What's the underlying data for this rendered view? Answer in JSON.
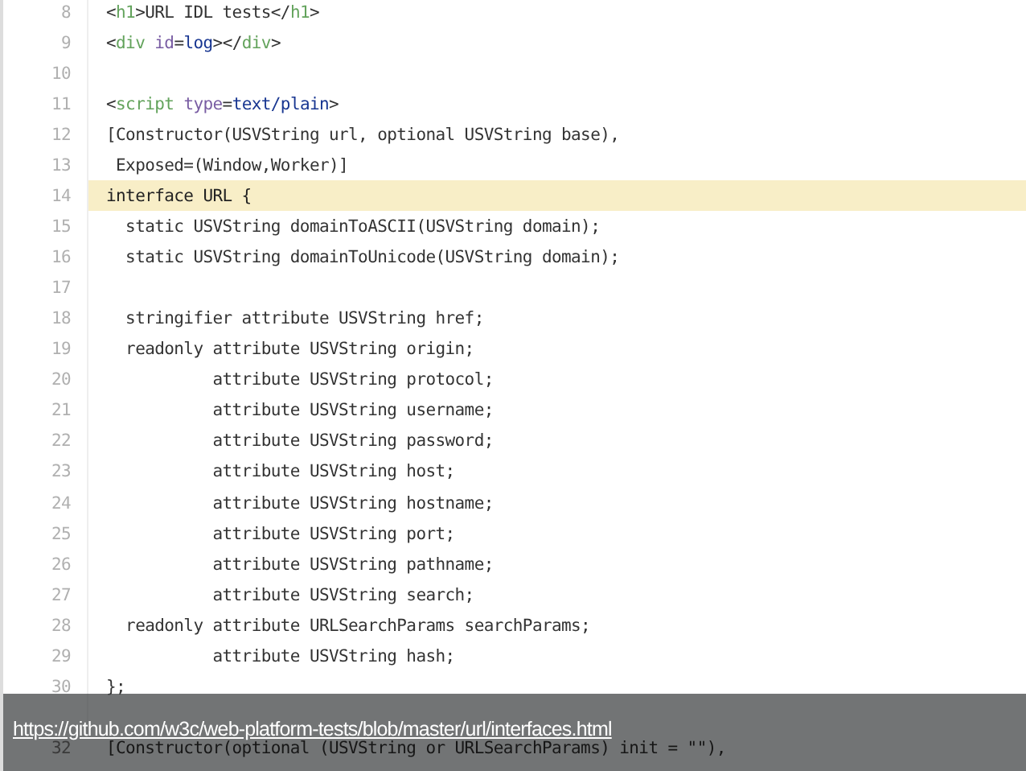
{
  "code_lines": [
    {
      "number": "8",
      "highlighted": false,
      "tokens": [
        {
          "text": "<",
          "kind": "plain"
        },
        {
          "text": "h1",
          "kind": "tag"
        },
        {
          "text": ">URL IDL tests</",
          "kind": "plain"
        },
        {
          "text": "h1",
          "kind": "tag"
        },
        {
          "text": ">",
          "kind": "plain"
        }
      ]
    },
    {
      "number": "9",
      "highlighted": false,
      "tokens": [
        {
          "text": "<",
          "kind": "plain"
        },
        {
          "text": "div",
          "kind": "tag"
        },
        {
          "text": " id",
          "kind": "attr"
        },
        {
          "text": "=",
          "kind": "plain"
        },
        {
          "text": "log",
          "kind": "value"
        },
        {
          "text": "></",
          "kind": "plain"
        },
        {
          "text": "div",
          "kind": "tag"
        },
        {
          "text": ">",
          "kind": "plain"
        }
      ]
    },
    {
      "number": "10",
      "highlighted": false
    },
    {
      "number": "11",
      "highlighted": false,
      "tokens": [
        {
          "text": "<",
          "kind": "plain"
        },
        {
          "text": "script",
          "kind": "tag"
        },
        {
          "text": " type",
          "kind": "attr"
        },
        {
          "text": "=",
          "kind": "plain"
        },
        {
          "text": "text/plain",
          "kind": "value"
        },
        {
          "text": ">",
          "kind": "plain"
        }
      ]
    },
    {
      "number": "12",
      "highlighted": false,
      "tokens": [
        {
          "text": "[Constructor(USVString url, optional USVString base),",
          "kind": "plain"
        }
      ]
    },
    {
      "number": "13",
      "highlighted": false,
      "tokens": [
        {
          "text": " Exposed=(Window,Worker)]",
          "kind": "plain"
        }
      ]
    },
    {
      "number": "14",
      "highlighted": true,
      "tokens": [
        {
          "text": "interface URL {",
          "kind": "plain"
        }
      ]
    },
    {
      "number": "15",
      "highlighted": false,
      "tokens": [
        {
          "text": "  static USVString domainToASCII(USVString domain);",
          "kind": "plain"
        }
      ]
    },
    {
      "number": "16",
      "highlighted": false,
      "tokens": [
        {
          "text": "  static USVString domainToUnicode(USVString domain);",
          "kind": "plain"
        }
      ]
    },
    {
      "number": "17",
      "highlighted": false
    },
    {
      "number": "18",
      "highlighted": false,
      "tokens": [
        {
          "text": "  stringifier attribute USVString href;",
          "kind": "plain"
        }
      ]
    },
    {
      "number": "19",
      "highlighted": false,
      "tokens": [
        {
          "text": "  readonly attribute USVString origin;",
          "kind": "plain"
        }
      ]
    },
    {
      "number": "20",
      "highlighted": false,
      "tokens": [
        {
          "text": "           attribute USVString protocol;",
          "kind": "plain"
        }
      ]
    },
    {
      "number": "21",
      "highlighted": false,
      "tokens": [
        {
          "text": "           attribute USVString username;",
          "kind": "plain"
        }
      ]
    },
    {
      "number": "22",
      "highlighted": false,
      "tokens": [
        {
          "text": "           attribute USVString password;",
          "kind": "plain"
        }
      ]
    },
    {
      "number": "23",
      "highlighted": false,
      "tokens": [
        {
          "text": "           attribute USVString host;",
          "kind": "plain"
        }
      ]
    },
    {
      "number": "24",
      "highlighted": false,
      "tokens": [
        {
          "text": "           attribute USVString hostname;",
          "kind": "plain"
        }
      ]
    },
    {
      "number": "25",
      "highlighted": false,
      "tokens": [
        {
          "text": "           attribute USVString port;",
          "kind": "plain"
        }
      ]
    },
    {
      "number": "26",
      "highlighted": false,
      "tokens": [
        {
          "text": "           attribute USVString pathname;",
          "kind": "plain"
        }
      ]
    },
    {
      "number": "27",
      "highlighted": false,
      "tokens": [
        {
          "text": "           attribute USVString search;",
          "kind": "plain"
        }
      ]
    },
    {
      "number": "28",
      "highlighted": false,
      "tokens": [
        {
          "text": "  readonly attribute URLSearchParams searchParams;",
          "kind": "plain"
        }
      ]
    },
    {
      "number": "29",
      "highlighted": false,
      "tokens": [
        {
          "text": "           attribute USVString hash;",
          "kind": "plain"
        }
      ]
    },
    {
      "number": "30",
      "highlighted": false,
      "tokens": [
        {
          "text": "};",
          "kind": "plain"
        }
      ]
    },
    {
      "number": "32",
      "highlighted": false,
      "tokens": [
        {
          "text": "[Constructor(optional (USVString or URLSearchParams) init = \"\"),",
          "kind": "plain"
        }
      ]
    }
  ],
  "caption": {
    "link": "https://github.com/w3c/web-platform-tests/blob/master/url/interfaces.html"
  }
}
